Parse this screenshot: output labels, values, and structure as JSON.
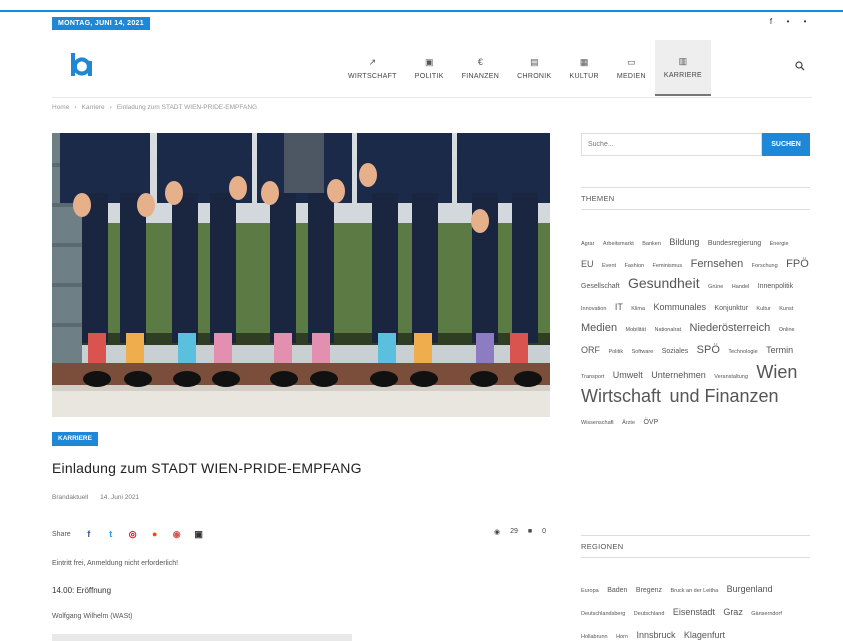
{
  "header": {
    "date": "MONTAG, JUNI 14, 2021",
    "social": [
      {
        "icon": "facebook-icon",
        "glyph": "f"
      },
      {
        "icon": "twitter-icon",
        "glyph": "•"
      },
      {
        "icon": "rss-icon",
        "glyph": "•"
      }
    ]
  },
  "nav": {
    "items": [
      {
        "label": "WIRTSCHAFT",
        "icon": "chart-icon",
        "glyph": "↗"
      },
      {
        "label": "POLITIK",
        "icon": "politics-icon",
        "glyph": "▣"
      },
      {
        "label": "FINANZEN",
        "icon": "euro-icon",
        "glyph": "€"
      },
      {
        "label": "CHRONIK",
        "icon": "calendar-icon",
        "glyph": "▤"
      },
      {
        "label": "KULTUR",
        "icon": "picture-icon",
        "glyph": "▦"
      },
      {
        "label": "MEDIEN",
        "icon": "monitor-icon",
        "glyph": "▭"
      },
      {
        "label": "KARRIERE",
        "icon": "briefcase-icon",
        "glyph": "▥"
      }
    ]
  },
  "breadcrumb": [
    "Home",
    "›",
    "Karriere",
    "›",
    "Einladung zum STADT WIEN-PRIDE-EMPFANG"
  ],
  "article": {
    "category": "KARRIERE",
    "title": "Einladung zum STADT WIEN-PRIDE-EMPFANG",
    "author": "Brandaktuell",
    "date": "14. Juni 2021",
    "share_label": "Share",
    "views": "29",
    "comments": "0",
    "p1": "Eintritt frei, Anmeldung nicht erforderlich!",
    "p2": "14.00: Eröffnung",
    "p3": "Wolfgang Wilhelm (WASt)"
  },
  "sidebar": {
    "search_placeholder": "Suche...",
    "search_button": "SUCHEN",
    "themen_title": "THEMEN",
    "regionen_title": "REGIONEN",
    "tags": [
      {
        "text": "Agrar",
        "size": "xs"
      },
      {
        "text": "Arbeitsmarkt",
        "size": "xs"
      },
      {
        "text": "Banken",
        "size": "xs"
      },
      {
        "text": "Bildung",
        "size": "m"
      },
      {
        "text": "Bundesregierung",
        "size": "s"
      },
      {
        "text": "Energie",
        "size": "xs"
      },
      {
        "text": "EU",
        "size": "m"
      },
      {
        "text": "Event",
        "size": "xs"
      },
      {
        "text": "Fashion",
        "size": "xs"
      },
      {
        "text": "Feminismus",
        "size": "xs"
      },
      {
        "text": "Fernsehen",
        "size": "l"
      },
      {
        "text": "Forschung",
        "size": "xs"
      },
      {
        "text": "FPÖ",
        "size": "l"
      },
      {
        "text": "Gesellschaft",
        "size": "s"
      },
      {
        "text": "Gesundheit",
        "size": "xl"
      },
      {
        "text": "Grüne",
        "size": "xs"
      },
      {
        "text": "Handel",
        "size": "xs"
      },
      {
        "text": "Innenpolitik",
        "size": "s"
      },
      {
        "text": "Innovation",
        "size": "xs"
      },
      {
        "text": "IT",
        "size": "m"
      },
      {
        "text": "Klima",
        "size": "xs"
      },
      {
        "text": "Kommunales",
        "size": "m"
      },
      {
        "text": "Konjunktur",
        "size": "s"
      },
      {
        "text": "Kultur",
        "size": "xs"
      },
      {
        "text": "Kunst",
        "size": "xs"
      },
      {
        "text": "Medien",
        "size": "l"
      },
      {
        "text": "Mobilität",
        "size": "xs"
      },
      {
        "text": "Nationalrat",
        "size": "xs"
      },
      {
        "text": "Niederösterreich",
        "size": "l"
      },
      {
        "text": "Online",
        "size": "xs"
      },
      {
        "text": "ORF",
        "size": "m"
      },
      {
        "text": "Politik",
        "size": "xs"
      },
      {
        "text": "Software",
        "size": "xs"
      },
      {
        "text": "Soziales",
        "size": "s"
      },
      {
        "text": "SPÖ",
        "size": "l"
      },
      {
        "text": "Technologie",
        "size": "xs"
      },
      {
        "text": "Termin",
        "size": "m"
      },
      {
        "text": "Transport",
        "size": "xs"
      },
      {
        "text": "Umwelt",
        "size": "m"
      },
      {
        "text": "Unternehmen",
        "size": "m"
      },
      {
        "text": "Veranstaltung",
        "size": "xs"
      },
      {
        "text": "Wien",
        "size": "xxl"
      },
      {
        "text": "Wirtschaft",
        "size": "xxl"
      },
      {
        "text": "und Finanzen",
        "size": "xxl"
      },
      {
        "text": "Wissenschaft",
        "size": "xs"
      },
      {
        "text": "Ärzte",
        "size": "xs"
      },
      {
        "text": "ÖVP",
        "size": "s"
      }
    ],
    "regions": [
      {
        "text": "Europa",
        "size": "xs"
      },
      {
        "text": "Baden",
        "size": "s"
      },
      {
        "text": "Bregenz",
        "size": "s"
      },
      {
        "text": "Bruck an der Leitha",
        "size": "xs"
      },
      {
        "text": "Burgenland",
        "size": "m"
      },
      {
        "text": "Deutschlandsberg",
        "size": "xs"
      },
      {
        "text": "Deutschland",
        "size": "xs"
      },
      {
        "text": "Eisenstadt",
        "size": "m"
      },
      {
        "text": "Graz",
        "size": "m"
      },
      {
        "text": "Gänserndorf",
        "size": "xs"
      },
      {
        "text": "Hollabrunn",
        "size": "xs"
      },
      {
        "text": "Horn",
        "size": "xs"
      },
      {
        "text": "Innsbruck",
        "size": "m"
      },
      {
        "text": "Klagenfurt",
        "size": "m"
      }
    ]
  },
  "colors": {
    "accent": "#1e88d6"
  }
}
